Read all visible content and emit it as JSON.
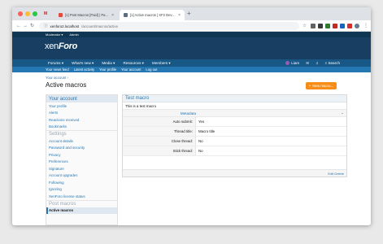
{
  "browser": {
    "tabs": [
      {
        "label": "[1] Post Macros [Paid] | Page 2 ..."
      },
      {
        "label": "[1] Active macros | XF2 Dev Fo..."
      }
    ],
    "url_host": "xenforo2.localhost",
    "url_path": "/account/macros/active"
  },
  "staff_bar": {
    "moderator": "Moderator ▾",
    "admin": "Admin"
  },
  "logo": {
    "main": "xen",
    "accent": "Foro"
  },
  "nav": {
    "items": [
      "Forums ▾",
      "What's new ▾",
      "Media ▾",
      "Resources ▾",
      "Members ▾"
    ],
    "user": "Liam",
    "search": "Search"
  },
  "subnav": [
    "Your news feed",
    "Latest activity",
    "Your profile",
    "Your account",
    "Log out"
  ],
  "page": {
    "breadcrumb": "Your account ›",
    "title": "Active macros",
    "new_button": "New macro..."
  },
  "sidebar": {
    "heading": "Your account",
    "group1": [
      "Your profile",
      "Alerts",
      "Reactions received",
      "Bookmarks"
    ],
    "settings_heading": "Settings",
    "group2": [
      "Account details",
      "Password and security",
      "Privacy",
      "Preferences",
      "Signature",
      "Account upgrades",
      "Following",
      "Ignoring",
      "XenForo license status"
    ],
    "post_macros_heading": "Post macros",
    "active_item": "Active macros"
  },
  "macro": {
    "title": "Test macro",
    "description": "This is a test macro",
    "metadata_label": "Metadata",
    "rows": [
      {
        "label": "Auto submit:",
        "value": "Yes"
      },
      {
        "label": "Thread title:",
        "value": "Macro title"
      },
      {
        "label": "Close thread:",
        "value": "No"
      },
      {
        "label": "Stick thread:",
        "value": "No"
      }
    ],
    "edit_link": "Edit Delete"
  }
}
